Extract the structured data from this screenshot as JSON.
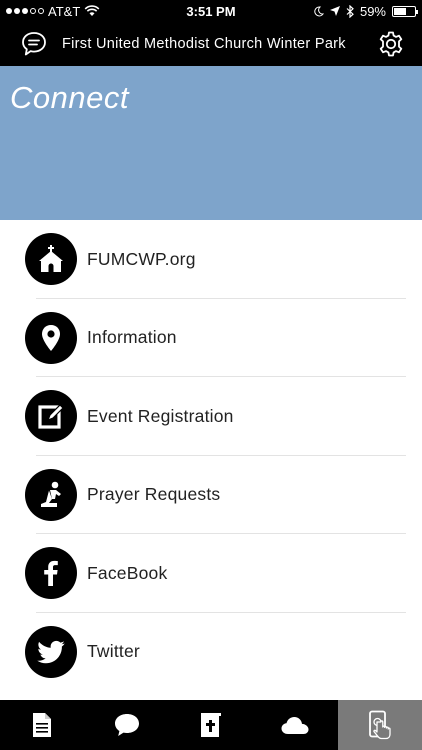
{
  "status_bar": {
    "carrier": "AT&T",
    "time": "3:51 PM",
    "battery": "59%",
    "battery_level": 0.59
  },
  "header": {
    "title": "First United Methodist Church Winter Park",
    "left_icon": "chat-bubble-icon",
    "right_icon": "gear-icon"
  },
  "banner": {
    "title": "Connect",
    "color": "#7ea4cb"
  },
  "list": {
    "items": [
      {
        "label": "FUMCWP.org",
        "icon": "church-icon"
      },
      {
        "label": "Information",
        "icon": "map-pin-icon"
      },
      {
        "label": "Event Registration",
        "icon": "edit-form-icon"
      },
      {
        "label": "Prayer Requests",
        "icon": "kneeling-prayer-icon"
      },
      {
        "label": "FaceBook",
        "icon": "facebook-icon"
      },
      {
        "label": "Twitter",
        "icon": "twitter-icon"
      }
    ]
  },
  "tab_bar": {
    "tabs": [
      {
        "icon": "document-icon",
        "active": false
      },
      {
        "icon": "chat-bubble-icon",
        "active": false
      },
      {
        "icon": "bible-icon",
        "active": false
      },
      {
        "icon": "cloud-icon",
        "active": false
      },
      {
        "icon": "tap-device-icon",
        "active": true
      }
    ],
    "active_color": "#7a7a7a"
  }
}
